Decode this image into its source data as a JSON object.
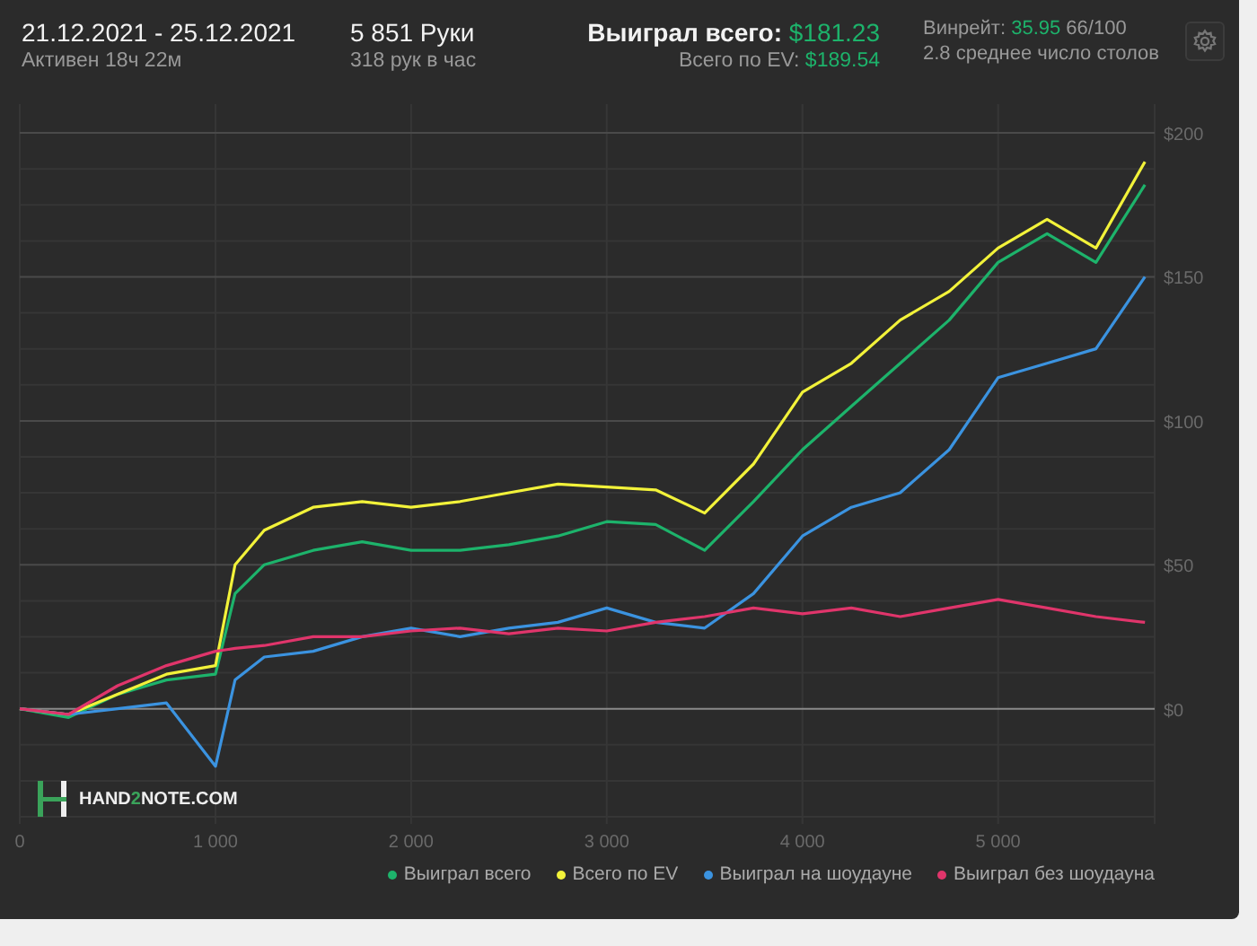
{
  "header": {
    "date_range": "21.12.2021 - 25.12.2021",
    "active": "Активен 18ч 22м",
    "hands": "5 851 Руки",
    "hands_per_hour": "318 рук в час",
    "won_label": "Выиграл всего:",
    "won_value": "$181.23",
    "ev_label": "Всего по EV:",
    "ev_value": "$189.54",
    "winrate_label": "Винрейт:",
    "winrate_value": "35.95",
    "winrate_extra": "66/100",
    "tables": "2.8 среднее число столов"
  },
  "logo": {
    "parts": [
      {
        "text": "HAND",
        "accent": false
      },
      {
        "text": "2",
        "accent": true
      },
      {
        "text": "NOTE.COM",
        "accent": false
      }
    ]
  },
  "chart": {
    "chart_data": {
      "type": "line",
      "grid": true,
      "x": [
        0,
        250,
        500,
        750,
        1000,
        1100,
        1250,
        1500,
        1750,
        2000,
        2250,
        2500,
        2750,
        3000,
        3250,
        3500,
        3750,
        4000,
        4250,
        4500,
        4750,
        5000,
        5250,
        5500,
        5750
      ],
      "xlim": [
        0,
        5800
      ],
      "ylim": [
        -40,
        210
      ],
      "xticks": [
        {
          "value": 0,
          "label": "0"
        },
        {
          "value": 1000,
          "label": "1 000"
        },
        {
          "value": 2000,
          "label": "2 000"
        },
        {
          "value": 3000,
          "label": "3 000"
        },
        {
          "value": 4000,
          "label": "4 000"
        },
        {
          "value": 5000,
          "label": "5 000"
        }
      ],
      "yticks": [
        {
          "value": 0,
          "label": "$0"
        },
        {
          "value": 50,
          "label": "$50"
        },
        {
          "value": 100,
          "label": "$100"
        },
        {
          "value": 150,
          "label": "$150"
        },
        {
          "value": 200,
          "label": "$200"
        }
      ],
      "series": [
        {
          "name": "Выиграл всего",
          "color": "#1db36b",
          "values": [
            0,
            -3,
            5,
            10,
            12,
            40,
            50,
            55,
            58,
            55,
            55,
            57,
            60,
            65,
            64,
            55,
            72,
            90,
            105,
            120,
            135,
            155,
            165,
            155,
            182
          ]
        },
        {
          "name": "Всего по EV",
          "color": "#f2f23a",
          "values": [
            0,
            -2,
            5,
            12,
            15,
            50,
            62,
            70,
            72,
            70,
            72,
            75,
            78,
            77,
            76,
            68,
            85,
            110,
            120,
            135,
            145,
            160,
            170,
            160,
            190
          ]
        },
        {
          "name": "Выиграл на шоудауне",
          "color": "#3b93e0",
          "values": [
            0,
            -2,
            0,
            2,
            -20,
            10,
            18,
            20,
            25,
            28,
            25,
            28,
            30,
            35,
            30,
            28,
            40,
            60,
            70,
            75,
            90,
            115,
            120,
            125,
            150
          ]
        },
        {
          "name": "Выиграл без шоудауна",
          "color": "#e0356b",
          "values": [
            0,
            -2,
            8,
            15,
            20,
            21,
            22,
            25,
            25,
            27,
            28,
            26,
            28,
            27,
            30,
            32,
            35,
            33,
            35,
            32,
            35,
            38,
            35,
            32,
            30
          ]
        }
      ]
    }
  }
}
